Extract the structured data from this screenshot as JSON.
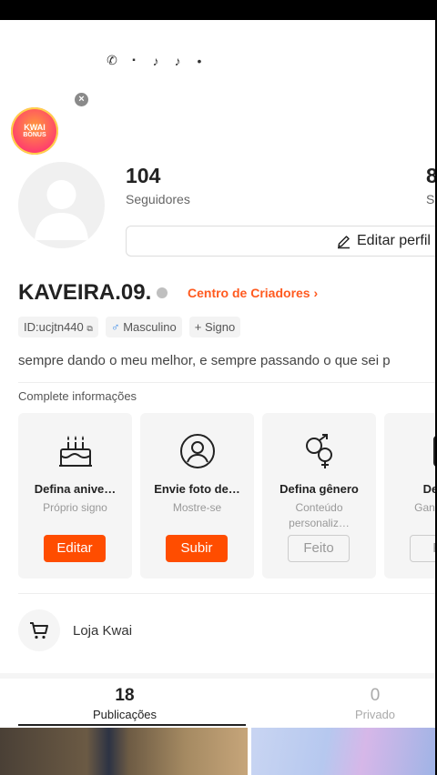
{
  "status_icons": [
    "phone-icon",
    "sim-icon",
    "tiktok-icon",
    "tiktok-icon",
    "dot-icon"
  ],
  "bonus": {
    "line1": "KWAI",
    "line2": "BÔNUS"
  },
  "stats": [
    {
      "value": "104",
      "label": "Seguidores"
    },
    {
      "value": "8",
      "label": "S"
    }
  ],
  "edit_profile_label": "Editar perfil",
  "profile": {
    "name": "KAVEIRA.09.",
    "creator_center": "Centro de Criadores",
    "id": "ID:ucjtn440",
    "gender": "Masculino",
    "sign": "+ Signo",
    "bio": "sempre dando o meu melhor, e sempre passando o que sei p"
  },
  "complete_title": "Complete informações",
  "cards": [
    {
      "title": "Defina anive…",
      "sub": "Próprio signo",
      "button": "Editar",
      "icon": "birthday-cake-icon"
    },
    {
      "title": "Envie foto de…",
      "sub": "Mostre-se",
      "button": "Subir",
      "icon": "user-circle-icon"
    },
    {
      "title": "Defina gênero",
      "sub": "Conteúdo personaliz…",
      "button": "Feito",
      "icon": "gender-icon"
    },
    {
      "title": "Defina",
      "sub": "Ganh segu",
      "button": "Fe",
      "icon": "phone-card-icon"
    }
  ],
  "shop_label": "Loja Kwai",
  "tabs": [
    {
      "count": "18",
      "label": "Publicações"
    },
    {
      "count": "0",
      "label": "Privado"
    }
  ],
  "colors": {
    "accent": "#ff4d00",
    "creator": "#ff5a1f"
  }
}
